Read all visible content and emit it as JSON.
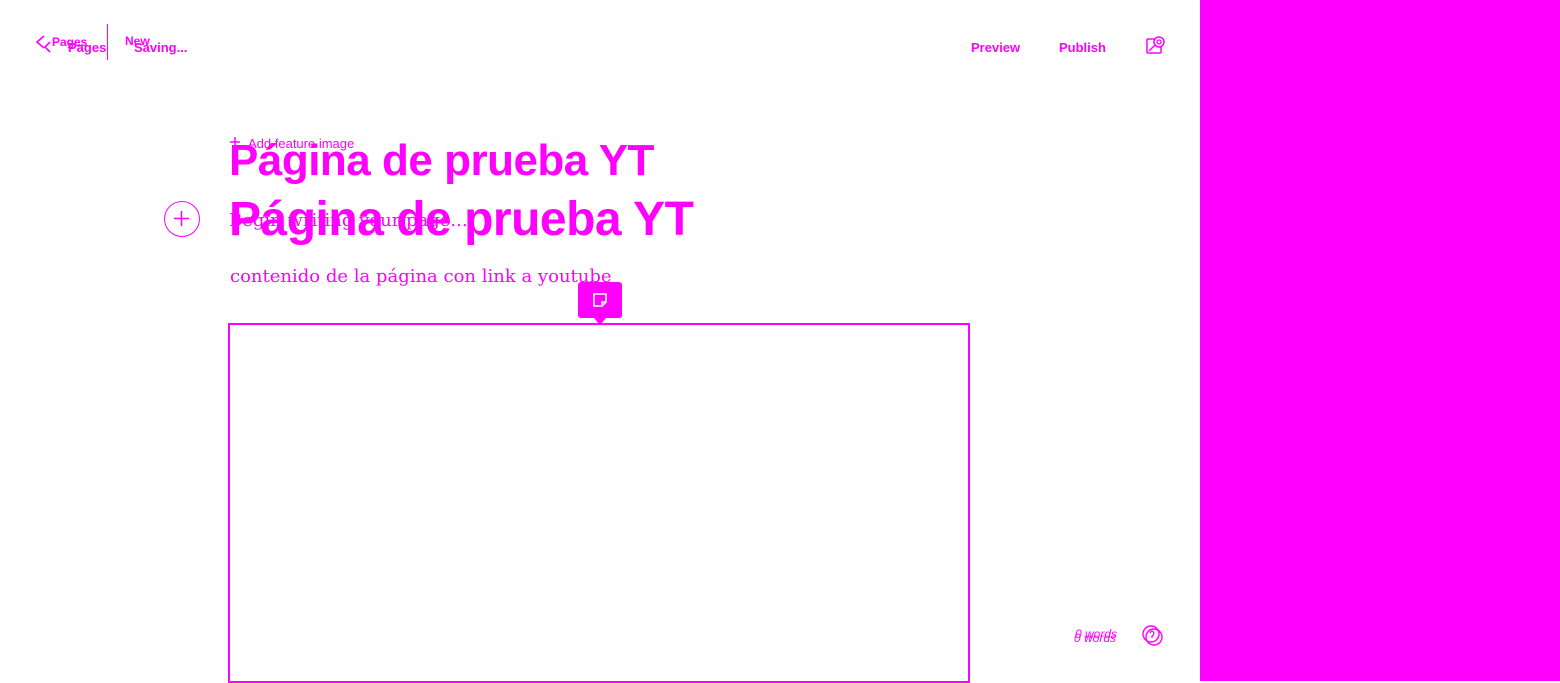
{
  "header": {
    "back_label_1": "Pages",
    "back_label_2": "Pages",
    "status_new": "New",
    "status_saving": "Saving...",
    "preview_label": "Preview",
    "publish_label": "Publish"
  },
  "editor": {
    "add_feature_image": "Add feature image",
    "title_ghost": "Página de prueba YT",
    "title": "Página de prueba YT",
    "body_placeholder": "Begin writing your page...",
    "body_text": "contenido de la página con link a youtube"
  },
  "footer": {
    "word_count_1": "0 words",
    "word_count_2": "0 words"
  },
  "colors": {
    "accent": "#ff00ff",
    "background": "#ffffff"
  },
  "icons": {
    "back": "chevron-left-icon",
    "settings": "settings-icon",
    "add": "plus-circle-icon",
    "card_menu": "card-note-icon",
    "help": "help-icon"
  }
}
